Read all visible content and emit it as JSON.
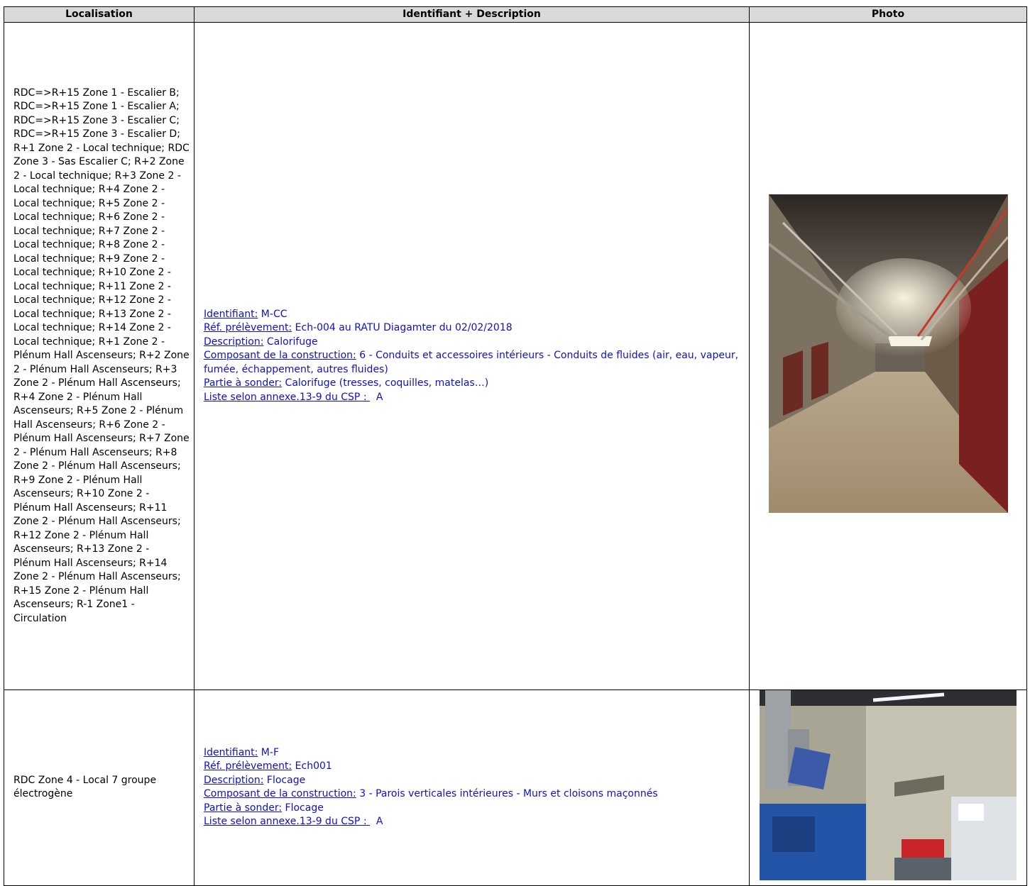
{
  "table": {
    "headers": [
      "Localisation",
      "Identifiant + Description",
      "Photo"
    ],
    "rows": [
      {
        "localisation": "RDC=>R+15 Zone 1 - Escalier B; RDC=>R+15 Zone 1 - Escalier A; RDC=>R+15 Zone 3 - Escalier C; RDC=>R+15 Zone 3 - Escalier D; R+1 Zone 2 - Local technique; RDC Zone 3 - Sas Escalier C; R+2 Zone 2 - Local technique; R+3 Zone 2 - Local technique; R+4 Zone 2 - Local technique; R+5 Zone 2 - Local technique; R+6 Zone 2 - Local technique; R+7 Zone 2 - Local technique; R+8 Zone 2 - Local technique; R+9 Zone 2 - Local technique; R+10 Zone 2 - Local technique; R+11 Zone 2 - Local technique; R+12 Zone 2 - Local technique; R+13 Zone 2 - Local technique; R+14 Zone 2 - Local technique; R+1 Zone 2 - Plénum Hall Ascenseurs; R+2 Zone 2 - Plénum Hall Ascenseurs; R+3 Zone 2 - Plénum Hall Ascenseurs; R+4 Zone 2 - Plénum Hall Ascenseurs; R+5 Zone 2 - Plénum Hall Ascenseurs; R+6 Zone 2 - Plénum Hall Ascenseurs; R+7 Zone 2 - Plénum Hall Ascenseurs; R+8 Zone 2 - Plénum Hall Ascenseurs; R+9 Zone 2 - Plénum Hall Ascenseurs; R+10 Zone 2 - Plénum Hall Ascenseurs; R+11 Zone 2 - Plénum Hall Ascenseurs; R+12 Zone 2 - Plénum Hall Ascenseurs; R+13 Zone 2 - Plénum Hall Ascenseurs; R+14 Zone 2 - Plénum Hall Ascenseurs; R+15 Zone 2 - Plénum Hall Ascenseurs; R-1 Zone1 - Circulation",
        "desc": {
          "identifiant_label": "Identifiant:",
          "identifiant": " M-CC",
          "ref_label": "Réf. prélèvement:",
          "ref": " Ech-004 au RATU Diagamter du 02/02/2018",
          "description_label": "Description:",
          "description": " Calorifuge",
          "composant_label": "Composant de la construction:",
          "composant": " 6 - Conduits et accessoires intérieurs - Conduits de fluides (air, eau, vapeur, fumée, échappement, autres fluides)",
          "partie_label": "Partie à sonder:",
          "partie": " Calorifuge (tresses, coquilles, matelas…)",
          "liste_label": "Liste selon annexe.13-9 du CSP : ",
          "liste": "  A"
        }
      },
      {
        "localisation": "RDC Zone 4 - Local 7 groupe électrogène",
        "desc": {
          "identifiant_label": "Identifiant:",
          "identifiant": " M-F",
          "ref_label": "Réf. prélèvement:",
          "ref": " Ech001",
          "description_label": "Description:",
          "description": " Flocage",
          "composant_label": "Composant de la construction:",
          "composant": " 3 - Parois verticales intérieures - Murs et cloisons maçonnés",
          "partie_label": "Partie à sonder:",
          "partie": " Flocage",
          "liste_label": "Liste selon annexe.13-9 du CSP : ",
          "liste": "  A"
        }
      }
    ]
  }
}
